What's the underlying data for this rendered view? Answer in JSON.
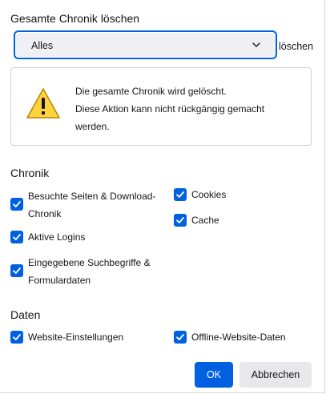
{
  "dialog": {
    "title": "Gesamte Chronik löschen",
    "range_suffix": "löschen",
    "range_select": {
      "value": "Alles",
      "chevron_icon": "chevron-down-icon"
    }
  },
  "warning": {
    "icon": "warning-icon",
    "line1": "Die gesamte Chronik wird gelöscht.",
    "line2": "Diese Aktion kann nicht rückgängig gemacht werden."
  },
  "history_section": {
    "heading": "Chronik",
    "items": [
      {
        "label": "Besuchte Seiten & Download-Chronik",
        "checked": true
      },
      {
        "label": "Aktive Logins",
        "checked": true
      },
      {
        "label": "Eingegebene Suchbegriffe & Formulardaten",
        "checked": true
      },
      {
        "label": "Cookies",
        "checked": true
      },
      {
        "label": "Cache",
        "checked": true
      }
    ]
  },
  "data_section": {
    "heading": "Daten",
    "items": [
      {
        "label": "Website-Einstellungen",
        "checked": true
      },
      {
        "label": "Offline-Website-Daten",
        "checked": true
      }
    ]
  },
  "buttons": {
    "ok": "OK",
    "cancel": "Abbrechen"
  },
  "colors": {
    "accent": "#0061e0",
    "warning_yellow": "#ffd33d"
  }
}
